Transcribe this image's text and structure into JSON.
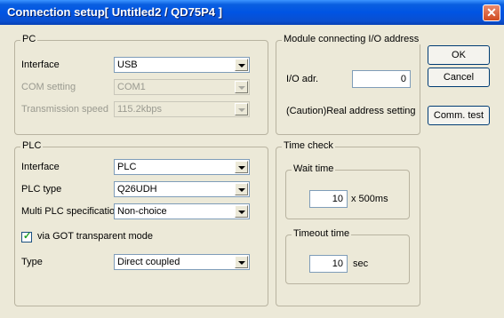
{
  "window": {
    "title": "Connection setup[ Untitled2 / QD75P4 ]",
    "close_symbol": "✕"
  },
  "pc": {
    "title": "PC",
    "interface_label": "Interface",
    "interface_value": "USB",
    "com_label": "COM setting",
    "com_value": "COM1",
    "speed_label": "Transmission speed",
    "speed_value": "115.2kbps"
  },
  "module": {
    "title": "Module connecting I/O address",
    "io_label": "I/O adr.",
    "io_value": "0",
    "caution": "(Caution)Real address setting"
  },
  "plc": {
    "title": "PLC",
    "interface_label": "Interface",
    "interface_value": "PLC",
    "type_label": "PLC type",
    "type_value": "Q26UDH",
    "multi_label": "Multi PLC specification",
    "multi_value": "Non-choice",
    "via_got_label": "via GOT transparent mode",
    "via_got_checked": true,
    "conn_type_label": "Type",
    "conn_type_value": "Direct coupled"
  },
  "time_check": {
    "title": "Time check",
    "wait_title": "Wait time",
    "wait_value": "10",
    "wait_unit": "x 500ms",
    "timeout_title": "Timeout time",
    "timeout_value": "10",
    "timeout_unit": "sec"
  },
  "buttons": {
    "ok": "OK",
    "cancel": "Cancel",
    "comm_test": "Comm. test"
  }
}
